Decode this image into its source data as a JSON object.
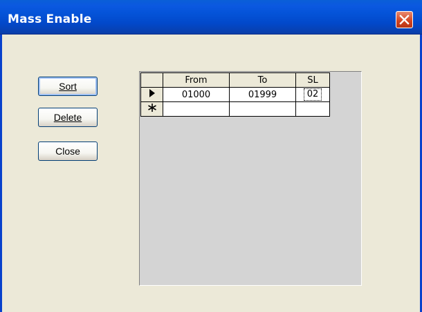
{
  "window": {
    "title": "Mass Enable"
  },
  "buttons": {
    "sort": "Sort",
    "delete": "Delete",
    "close": "Close"
  },
  "grid": {
    "columns": [
      "From",
      "To",
      "SL"
    ],
    "rows": [
      {
        "indicator": "current-row-arrow",
        "from": "01000",
        "to": "01999",
        "sl": "02"
      },
      {
        "indicator": "new-row-asterisk",
        "from": "",
        "to": "",
        "sl": ""
      }
    ]
  }
}
